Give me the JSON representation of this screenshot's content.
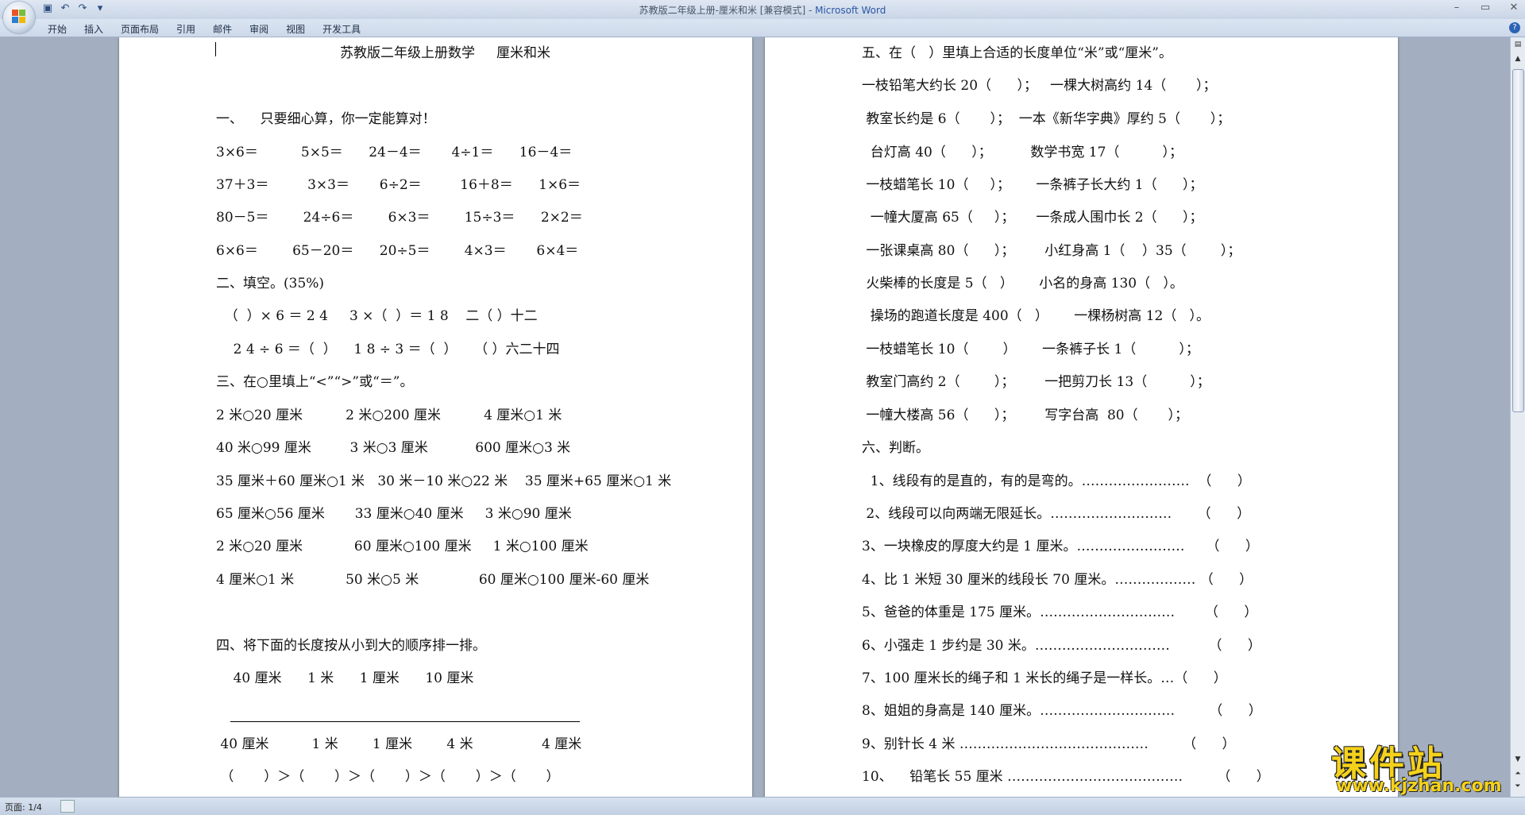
{
  "window": {
    "title": "苏教版二年级上册-厘米和米 [兼容模式] - ",
    "app_name": "Microsoft Word"
  },
  "ribbon": {
    "tabs": [
      "开始",
      "插入",
      "页面布局",
      "引用",
      "邮件",
      "审阅",
      "视图",
      "开发工具"
    ]
  },
  "left_page": {
    "lines": [
      "苏教版二年级上册数学     厘米和米",
      "",
      "一、    只要细心算，你一定能算对！",
      "3×6＝          5×5＝      24－4＝       4÷1＝      16－4＝",
      "37＋3＝         3×3＝       6÷2＝         16＋8＝      1×6＝",
      "80－5＝        24÷6＝        6×3＝        15÷3＝      2×2＝",
      "6×6＝        65－20＝      20÷5＝        4×3＝       6×4＝",
      "二、填空。(35%)",
      "  （  ）× 6 ＝ 2 4     3 ×（  ）＝ 1 8    二（ ）十二",
      "    2 4 ÷ 6 ＝（  ）    1 8 ÷ 3 ＝（  ）    （ ）六二十四",
      "三、在○里填上“<”“>”或“＝”。",
      "2 米○20 厘米          2 米○200 厘米          4 厘米○1 米",
      "40 米○99 厘米         3 米○3 厘米           600 厘米○3 米",
      "35 厘米＋60 厘米○1 米   30 米－10 米○22 米    35 厘米+65 厘米○1 米",
      "65 厘米○56 厘米       33 厘米○40 厘米     3 米○90 厘米",
      "2 米○20 厘米            60 厘米○100 厘米     1 米○100 厘米",
      "4 厘米○1 米            50 米○5 米              60 厘米○100 厘米-60 厘米",
      "",
      "四、将下面的长度按从小到大的顺序排一排。",
      "    40 厘米      1 米      1 厘米      10 厘米",
      "",
      " 40 厘米          1 米        1 厘米        4 米                4 厘米",
      " （       ）＞（       ）＞（       ）＞（       ）＞（       ）"
    ]
  },
  "right_page": {
    "lines": [
      "五、在（   ）里填上合适的长度单位“米”或“厘米”。",
      "一枝铅笔大约长 20（      ）；   一棵大树高约 14（       ）；",
      " 教室长约是 6（       ）；  一本《新华字典》厚约 5（       ）；",
      "  台灯高 40（      ）；         数学书宽 17（          ）；",
      " 一枝蜡笔长 10（     ）；      一条裤子长大约 1（      ）；",
      "  一幢大厦高 65（     ）；     一条成人围巾长 2（      ）；",
      " 一张课桌高 80（      ）；       小红身高 1（    ）35（        ）；",
      " 火柴棒的长度是 5（   ）      小名的身高 130（   ）。",
      "  操场的跑道长度是 400（   ）      一棵杨树高 12（   ）。",
      " 一枝蜡笔长 10（        ）      一条裤子长 1（          ）；",
      " 教室门高约 2（        ）；       一把剪刀长 13（          ）；",
      " 一幢大楼高 56（      ）；       写字台高  80（       ）；",
      "六、判断。",
      "  1、线段有的是直的，有的是弯的。……………………  （      ）",
      " 2、线段可以向两端无限延长。………………………      （      ）",
      "3、一块橡皮的厚度大约是 1 厘米。……………………     （      ）",
      "4、比 1 米短 30 厘米的线段长 70 厘米。……………… （      ）",
      "5、爸爸的体重是 175 厘米。…………………………       （      ）",
      "6、小强走 1 步约是 30 米。…………………………         （      ）",
      "7、100 厘米长的绳子和 1 米长的绳子是一样长。…（      ）",
      "8、姐姐的身高是 140 厘米。…………………………        （      ）",
      "9、别针长 4 米 ……………………………………        （      ）",
      "10、    铅笔长 55 厘米 …………………………………        （      ）"
    ]
  },
  "status": {
    "page_indicator": "页面: 1/4"
  },
  "watermark": {
    "title": "课件站",
    "url": "www.kjzhan.com"
  },
  "colors": {
    "title_app": "#2a57a6",
    "doc_background": "#a3aec0",
    "watermark": "#f5d21a"
  }
}
